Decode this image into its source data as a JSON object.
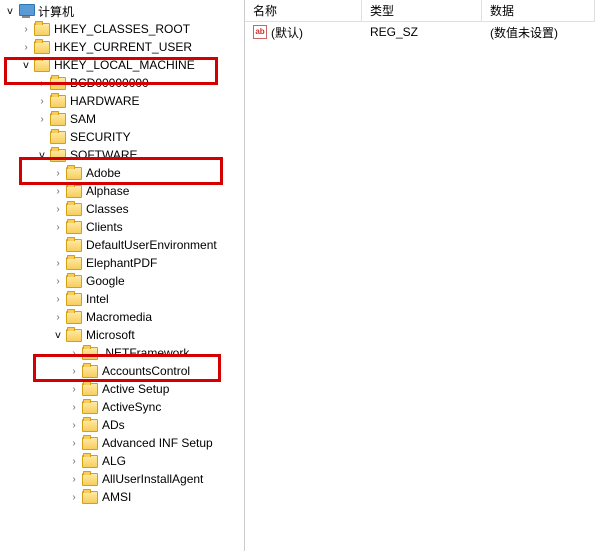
{
  "list": {
    "headers": {
      "name": "名称",
      "type": "类型",
      "data": "数据"
    },
    "rows": [
      {
        "name": "(默认)",
        "type": "REG_SZ",
        "data": "(数值未设置)"
      }
    ]
  },
  "tree": {
    "root": "计算机",
    "hkcr": "HKEY_CLASSES_ROOT",
    "hkcu": "HKEY_CURRENT_USER",
    "hklm": "HKEY_LOCAL_MACHINE",
    "bcd": "BCD00000000",
    "hardware": "HARDWARE",
    "sam": "SAM",
    "security": "SECURITY",
    "software": "SOFTWARE",
    "adobe": "Adobe",
    "alphase": "Alphase",
    "classes": "Classes",
    "clients": "Clients",
    "due": "DefaultUserEnvironment",
    "elephant": "ElephantPDF",
    "google": "Google",
    "intel": "Intel",
    "macromedia": "Macromedia",
    "microsoft": "Microsoft",
    "netfw": ".NETFramework",
    "accctl": "AccountsControl",
    "actset": "Active Setup",
    "actsync": "ActiveSync",
    "ads": "ADs",
    "advinf": "Advanced INF Setup",
    "alg": "ALG",
    "allusr": "AllUserInstallAgent",
    "amsi": "AMSI"
  }
}
